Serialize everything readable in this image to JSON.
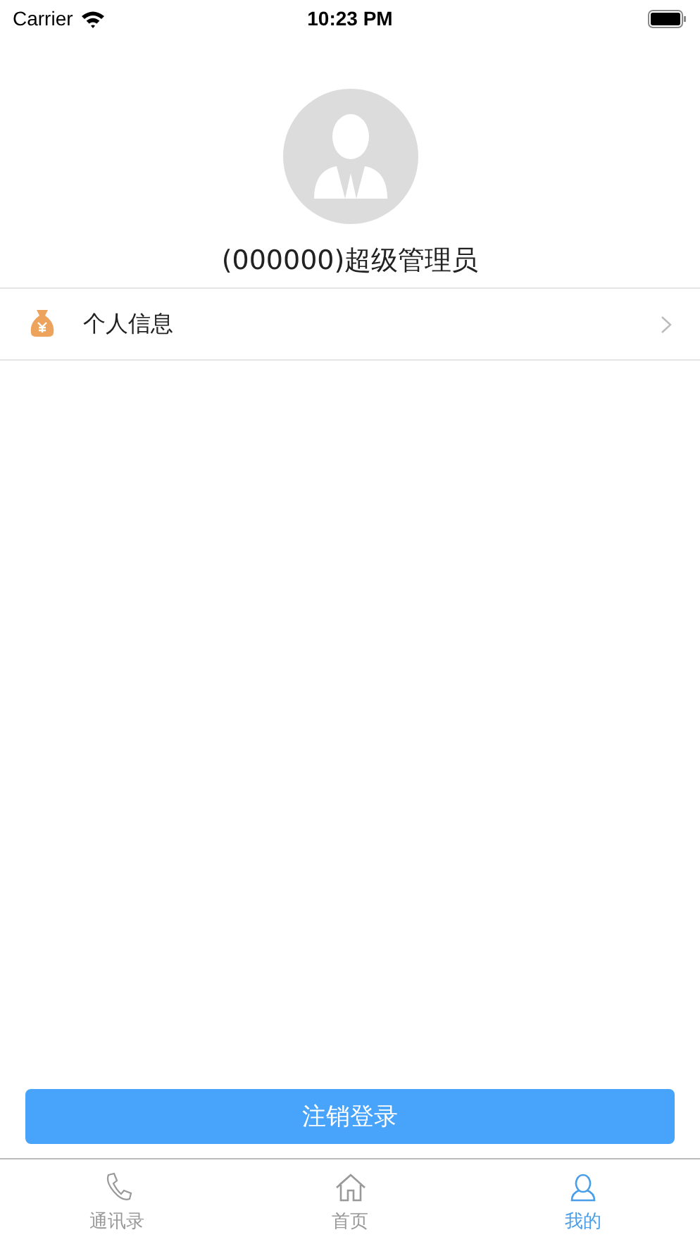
{
  "status_bar": {
    "carrier": "Carrier",
    "time": "10:23 PM"
  },
  "profile": {
    "name": "(000000)超级管理员"
  },
  "menu_items": [
    {
      "label": "个人信息",
      "kind": "money-bag"
    }
  ],
  "logout_button": "注销登录",
  "tabs": [
    {
      "label": "通讯录",
      "kind": "phone",
      "selected": false
    },
    {
      "label": "首页",
      "kind": "home",
      "selected": false
    },
    {
      "label": "我的",
      "kind": "person",
      "selected": true
    }
  ]
}
